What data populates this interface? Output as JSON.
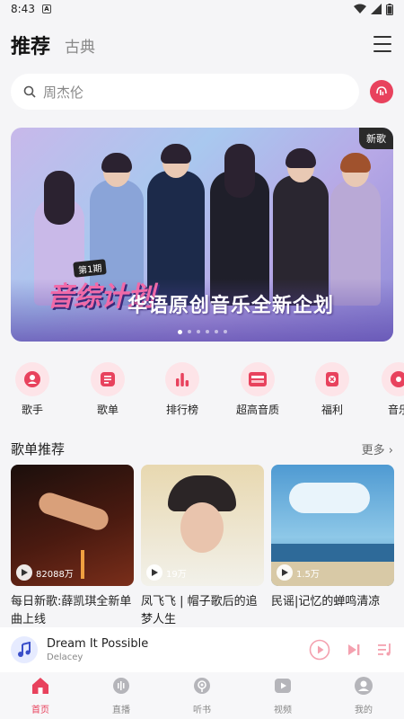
{
  "status_bar": {
    "time": "8:43",
    "notification_icon": "a-box-icon"
  },
  "header": {
    "tab_main": "推荐",
    "tab_sub": "古典",
    "menu_icon": "menu-icon"
  },
  "search": {
    "placeholder": "周杰伦",
    "voice_icon": "music-voice-icon"
  },
  "banner": {
    "badge": "新歌",
    "episode": "第1期",
    "logo_text": "音综计划",
    "title": "华语原创音乐全新企划",
    "dots_count": 6,
    "active_dot": 0
  },
  "quick_links": [
    {
      "label": "歌手",
      "icon": "singer-icon"
    },
    {
      "label": "歌单",
      "icon": "playlist-icon"
    },
    {
      "label": "排行榜",
      "icon": "chart-icon"
    },
    {
      "label": "超高音质",
      "icon": "hifi-icon"
    },
    {
      "label": "福利",
      "icon": "gift-icon"
    },
    {
      "label": "音乐",
      "icon": "music-icon"
    }
  ],
  "section": {
    "title": "歌单推荐",
    "more": "更多"
  },
  "playlists": [
    {
      "title": "每日新歌:薛凯琪全新单曲上线",
      "plays": "82088万",
      "color_a": "#1b0f0c",
      "color_b": "#7a2e1a"
    },
    {
      "title": "凤飞飞 | 帽子歌后的追梦人生",
      "plays": "19万",
      "color_a": "#e8d8b0",
      "color_b": "#f2f1ea"
    },
    {
      "title": "民谣|记忆的蝉鸣清凉",
      "plays": "1.5万",
      "color_a": "#4f9ad2",
      "color_b": "#8ec8e8"
    }
  ],
  "player": {
    "song": "Dream It Possible",
    "artist": "Delacey"
  },
  "nav": [
    {
      "label": "首页",
      "active": true
    },
    {
      "label": "直播",
      "active": false
    },
    {
      "label": "听书",
      "active": false
    },
    {
      "label": "视频",
      "active": false
    },
    {
      "label": "我的",
      "active": false
    }
  ],
  "colors": {
    "accent": "#e8425d",
    "background": "#f5f5f7"
  }
}
